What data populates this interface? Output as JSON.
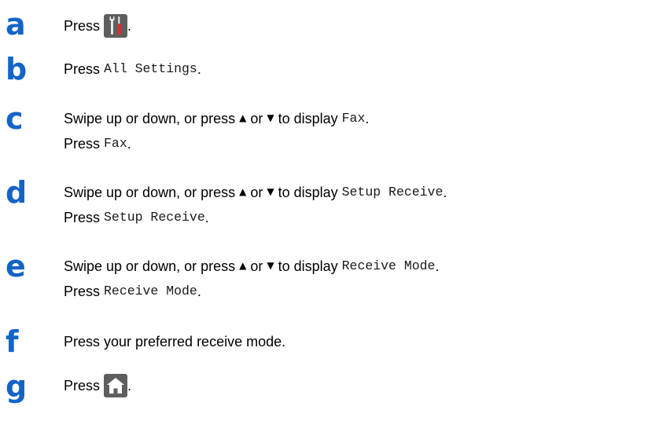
{
  "colors": {
    "step_letter": "#1464c8",
    "icon_button_bg": "#5e5e5e",
    "screwdriver_handle": "#d72f2f"
  },
  "steps": {
    "a": {
      "letter": "a",
      "line1": {
        "pre": "Press",
        "icon": "settings-tools-icon",
        "post": "."
      }
    },
    "b": {
      "letter": "b",
      "line1": {
        "pre": "Press",
        "code": "All Settings",
        "post": "."
      }
    },
    "c": {
      "letter": "c",
      "line1": {
        "pre": "Swipe up or down, or press",
        "up": "▲",
        "or": "or",
        "down": "▼",
        "mid": "to display",
        "code": "Fax",
        "post": "."
      },
      "line2": {
        "pre": "Press",
        "code": "Fax",
        "post": "."
      }
    },
    "d": {
      "letter": "d",
      "line1": {
        "pre": "Swipe up or down, or press",
        "up": "▲",
        "or": "or",
        "down": "▼",
        "mid": "to display",
        "code": "Setup Receive",
        "post": "."
      },
      "line2": {
        "pre": "Press",
        "code": "Setup Receive",
        "post": "."
      }
    },
    "e": {
      "letter": "e",
      "line1": {
        "pre": "Swipe up or down, or press",
        "up": "▲",
        "or": "or",
        "down": "▼",
        "mid": "to display",
        "code": "Receive Mode",
        "post": "."
      },
      "line2": {
        "pre": "Press",
        "code": "Receive Mode",
        "post": "."
      }
    },
    "f": {
      "letter": "f",
      "line1": {
        "text": "Press your preferred receive mode."
      }
    },
    "g": {
      "letter": "g",
      "line1": {
        "pre": "Press",
        "icon": "home-icon",
        "post": "."
      }
    }
  }
}
